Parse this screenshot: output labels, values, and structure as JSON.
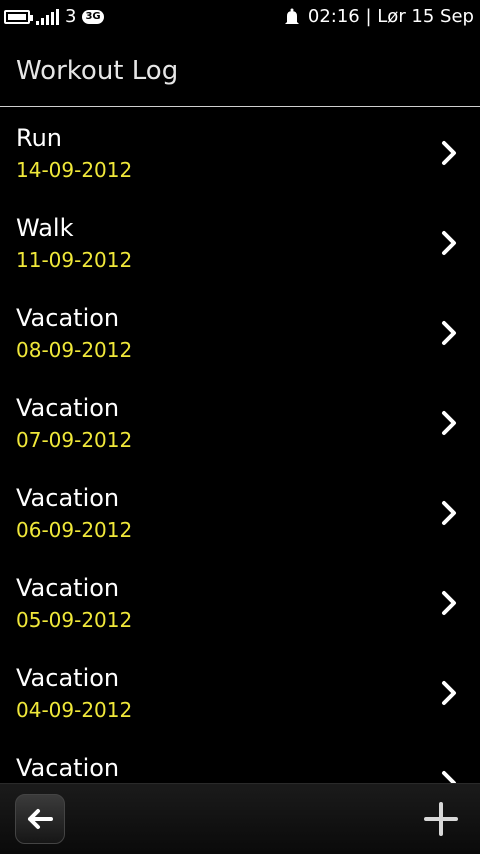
{
  "status": {
    "battery_icon": "battery-icon",
    "signal_icon": "signal-bars-icon",
    "signal_number": "3",
    "network": "3G",
    "notification_icon": "notification-bell-icon",
    "time_date": "02:16 | Lør 15 Sep"
  },
  "header": {
    "title": "Workout Log"
  },
  "list": {
    "items": [
      {
        "title": "Run",
        "date": "14-09-2012"
      },
      {
        "title": "Walk",
        "date": "11-09-2012"
      },
      {
        "title": "Vacation",
        "date": "08-09-2012"
      },
      {
        "title": "Vacation",
        "date": "07-09-2012"
      },
      {
        "title": "Vacation",
        "date": "06-09-2012"
      },
      {
        "title": "Vacation",
        "date": "05-09-2012"
      },
      {
        "title": "Vacation",
        "date": "04-09-2012"
      },
      {
        "title": "Vacation",
        "date": ""
      }
    ]
  },
  "toolbar": {
    "back_icon": "back-arrow-icon",
    "add_icon": "plus-icon"
  },
  "colors": {
    "date": "#f0e83a",
    "background": "#000000",
    "text": "#ffffff"
  }
}
